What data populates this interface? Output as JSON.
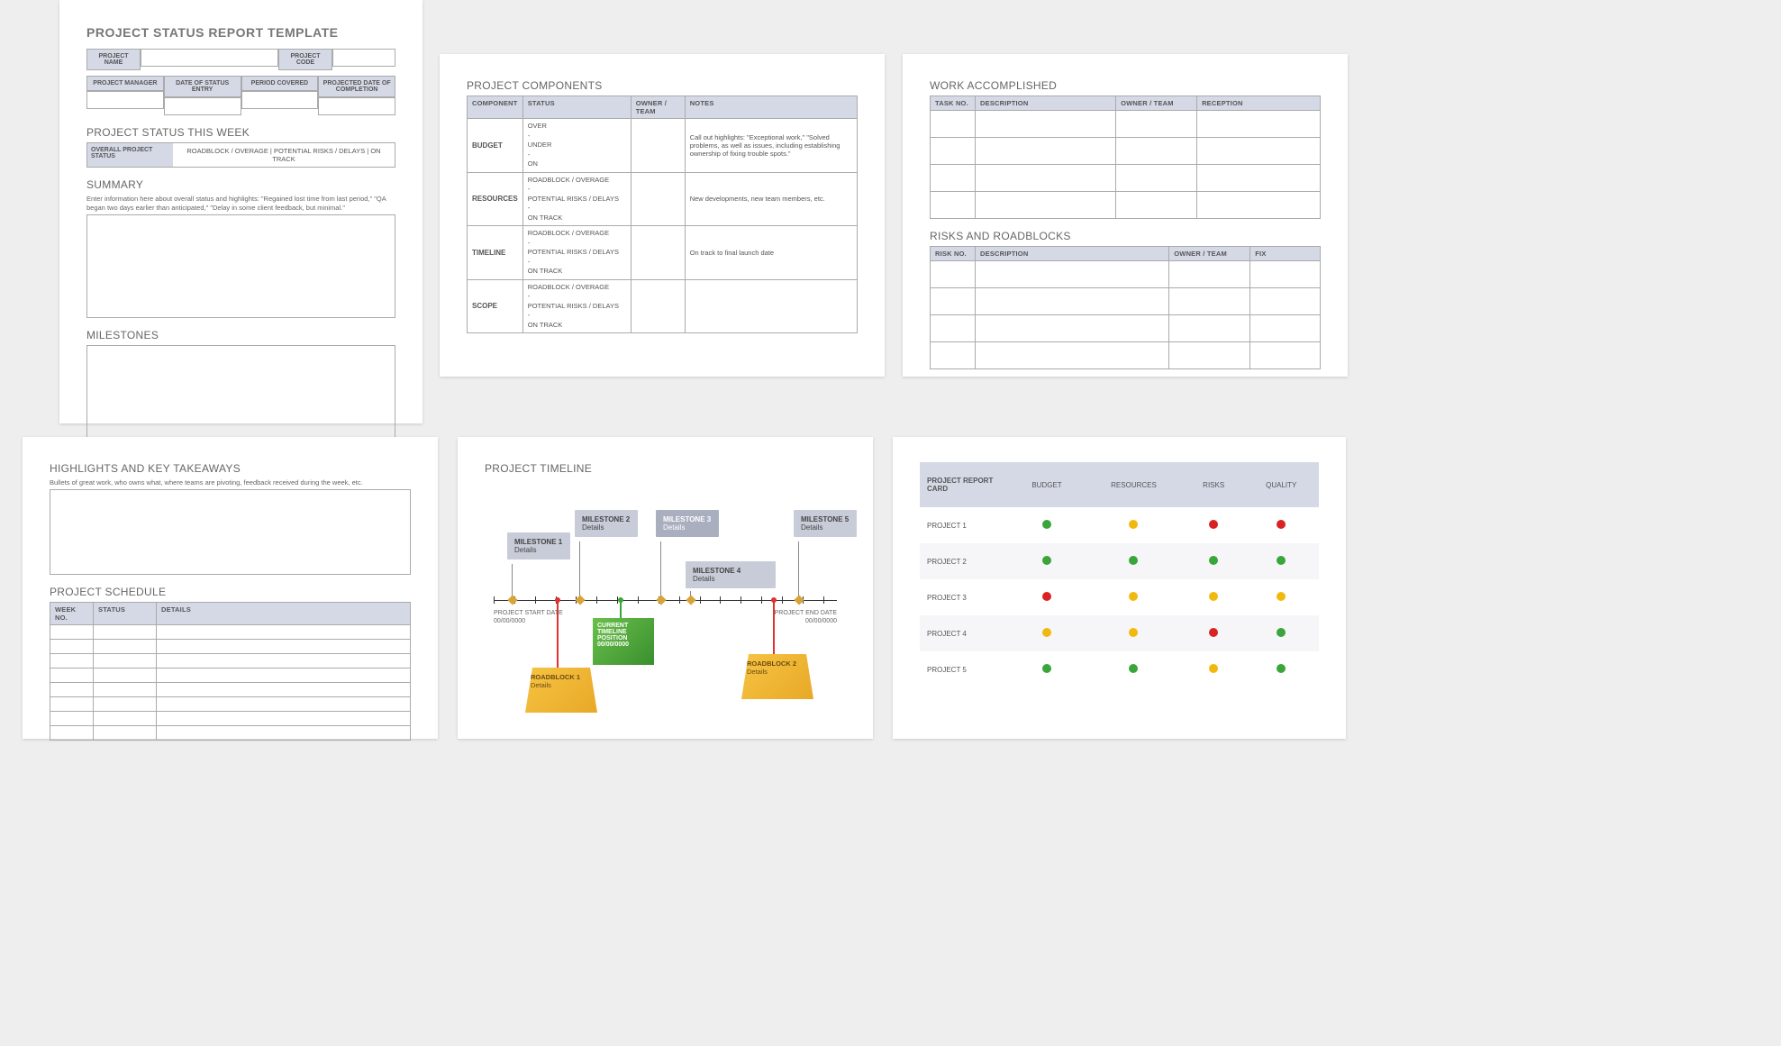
{
  "p1": {
    "title": "PROJECT STATUS REPORT TEMPLATE",
    "projectNameLbl": "PROJECT NAME",
    "projectCodeLbl": "PROJECT CODE",
    "hdr": [
      "PROJECT MANAGER",
      "DATE OF STATUS ENTRY",
      "PERIOD COVERED",
      "PROJECTED DATE OF COMPLETION"
    ],
    "statusWeek": "PROJECT STATUS THIS WEEK",
    "overallLbl": "OVERALL PROJECT STATUS",
    "statusOpts": "ROADBLOCK / OVERAGE   |   POTENTIAL RISKS / DELAYS   |   ON TRACK",
    "summary": "SUMMARY",
    "summaryHint": "Enter information here about overall status and highlights: \"Regained lost time from last period,\" \"QA began two days earlier than anticipated,\" \"Delay in some client feedback, but minimal.\"",
    "milestones": "MILESTONES"
  },
  "p2": {
    "title": "PROJECT COMPONENTS",
    "cols": [
      "COMPONENT",
      "STATUS",
      "OWNER / TEAM",
      "NOTES"
    ],
    "rows": [
      {
        "c": "BUDGET",
        "s": "OVER\n-\nUNDER\n-\nON",
        "n": "Call out highlights: \"Exceptional work,\" \"Solved problems, as well as issues, including establishing ownership of fixing trouble spots.\""
      },
      {
        "c": "RESOURCES",
        "s": "ROADBLOCK / OVERAGE\n-\nPOTENTIAL RISKS / DELAYS\n-\nON TRACK",
        "n": "New developments, new team members, etc."
      },
      {
        "c": "TIMELINE",
        "s": "ROADBLOCK / OVERAGE\n-\nPOTENTIAL RISKS / DELAYS\n-\nON TRACK",
        "n": "On track to final launch date"
      },
      {
        "c": "SCOPE",
        "s": "ROADBLOCK / OVERAGE\n-\nPOTENTIAL RISKS / DELAYS\n-\nON TRACK",
        "n": ""
      }
    ]
  },
  "p3": {
    "work": "WORK ACCOMPLISHED",
    "workCols": [
      "TASK NO.",
      "DESCRIPTION",
      "OWNER / TEAM",
      "RECEPTION"
    ],
    "risks": "RISKS AND ROADBLOCKS",
    "riskCols": [
      "RISK NO.",
      "DESCRIPTION",
      "OWNER / TEAM",
      "FIX"
    ]
  },
  "p4": {
    "title": "HIGHLIGHTS AND KEY TAKEAWAYS",
    "hint": "Bullets of great work, who owns what, where teams are pivoting, feedback received during the week, etc.",
    "sched": "PROJECT SCHEDULE",
    "schedCols": [
      "WEEK NO.",
      "STATUS",
      "DETAILS"
    ]
  },
  "p5": {
    "title": "PROJECT TIMELINE",
    "ms": [
      {
        "t": "MILESTONE 1",
        "d": "Details"
      },
      {
        "t": "MILESTONE 2",
        "d": "Details"
      },
      {
        "t": "MILESTONE 3",
        "d": "Details"
      },
      {
        "t": "MILESTONE 4",
        "d": "Details"
      },
      {
        "t": "MILESTONE 5",
        "d": "Details"
      }
    ],
    "start": {
      "l": "PROJECT START DATE",
      "d": "00/00/0000"
    },
    "end": {
      "l": "PROJECT END DATE",
      "d": "00/00/0000"
    },
    "cur": {
      "l1": "CURRENT",
      "l2": "TIMELINE",
      "l3": "POSITION",
      "d": "00/00/0000"
    },
    "rb": [
      {
        "t": "ROADBLOCK 1",
        "d": "Details"
      },
      {
        "t": "ROADBLOCK 2",
        "d": "Details"
      }
    ]
  },
  "p6": {
    "hdr": "PROJECT REPORT CARD",
    "cols": [
      "BUDGET",
      "RESOURCES",
      "RISKS",
      "QUALITY"
    ],
    "rows": [
      {
        "p": "PROJECT 1",
        "s": [
          "g",
          "y",
          "r",
          "r"
        ]
      },
      {
        "p": "PROJECT 2",
        "s": [
          "g",
          "g",
          "g",
          "g"
        ]
      },
      {
        "p": "PROJECT 3",
        "s": [
          "r",
          "y",
          "y",
          "y"
        ]
      },
      {
        "p": "PROJECT 4",
        "s": [
          "y",
          "y",
          "r",
          "g"
        ]
      },
      {
        "p": "PROJECT 5",
        "s": [
          "g",
          "g",
          "y",
          "g"
        ]
      }
    ]
  }
}
